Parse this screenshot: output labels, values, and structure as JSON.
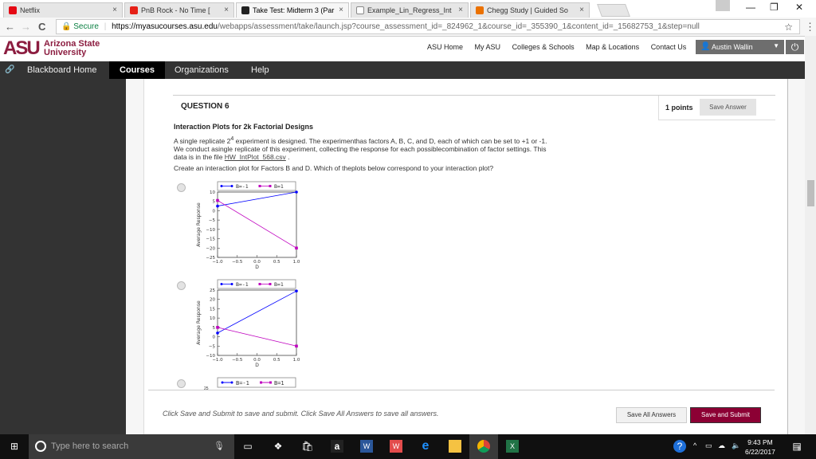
{
  "browser": {
    "tabs": [
      {
        "title": "Netflix",
        "favicon": "netflix-icon",
        "color": "#e50914"
      },
      {
        "title": "PnB Rock - No Time [",
        "favicon": "youtube-icon",
        "color": "#e62117",
        "audio": "◀"
      },
      {
        "title": "Take Test: Midterm 3 (Par",
        "favicon": "blackboard-icon",
        "color": "#222222",
        "active": true
      },
      {
        "title": "Example_Lin_Regress_Int",
        "favicon": "document-icon",
        "color": "#888888"
      },
      {
        "title": "Chegg Study | Guided So",
        "favicon": "chegg-icon",
        "color": "#eb7100"
      }
    ],
    "tab_close": "×",
    "address": {
      "secure_label": "Secure",
      "host": "https://myasucourses.asu.edu",
      "path": "/webapps/assessment/take/launch.jsp?course_assessment_id=_824962_1&course_id=_355390_1&content_id=_15682753_1&step=null"
    },
    "nav": {
      "back": "←",
      "forward": "→",
      "reload": "C"
    },
    "bookmark_icon": "☆",
    "menu_icon": "⋮",
    "window": {
      "minimize": "—",
      "maximize": "❐",
      "close": "✕",
      "profile": "▲"
    }
  },
  "asu_header": {
    "logo": "ASU",
    "name_line1": "Arizona State",
    "name_line2": "University",
    "links": [
      "ASU Home",
      "My ASU",
      "Colleges & Schools",
      "Map & Locations",
      "Contact Us"
    ],
    "user": "Austin Wallin",
    "power_icon": "⏻"
  },
  "bb_nav": {
    "items": [
      "Blackboard Home",
      "Courses",
      "Organizations",
      "Help"
    ],
    "active": "Courses"
  },
  "question": {
    "title": "QUESTION 6",
    "points": "1 points",
    "save_answer": "Save Answer",
    "heading": "Interaction Plots for 2k Factorial Designs",
    "p1_a": "A single replicate 2",
    "p1_sup": "4",
    "p1_b": " experiment is designed. The experimenthas factors A, B, C, and D, each of which can be set to +1 or -1.",
    "p2": "We conduct asingle replicate of this experiment, collecting the response for each possiblecombination of factor settings. This",
    "p3_a": "data is in the file ",
    "p3_link": "HW_IntPlot_568.csv",
    "p3_b": " .",
    "p4": "Create an interaction plot for Factors B and D. Which of theplots below correspond to your interaction plot?"
  },
  "chart_data": [
    {
      "type": "line",
      "title": "",
      "xlabel": "D",
      "ylabel": "Average Response",
      "x": [
        -1,
        1
      ],
      "xlim": [
        -1.0,
        1.0
      ],
      "ylim": [
        -25,
        10
      ],
      "xticks": [
        "−1.0",
        "−0.5",
        "0.0",
        "0.5",
        "1.0"
      ],
      "yticks": [
        10,
        5,
        0,
        -5,
        -10,
        -15,
        -20,
        -25
      ],
      "legend": "top",
      "series": [
        {
          "name": "B=-1",
          "values": [
            2.5,
            10
          ],
          "color": "#0000ff",
          "marker": "circle"
        },
        {
          "name": "B=1",
          "values": [
            5.5,
            -20
          ],
          "color": "#bf00bf",
          "marker": "square"
        }
      ]
    },
    {
      "type": "line",
      "title": "",
      "xlabel": "D",
      "ylabel": "Average Response",
      "x": [
        -1,
        1
      ],
      "xlim": [
        -1.0,
        1.0
      ],
      "ylim": [
        -10,
        25
      ],
      "xticks": [
        "−1.0",
        "−0.5",
        "0.0",
        "0.5",
        "1.0"
      ],
      "yticks": [
        25,
        20,
        15,
        10,
        5,
        0,
        -5,
        -10
      ],
      "legend": "top",
      "series": [
        {
          "name": "B=-1",
          "values": [
            2,
            24.5
          ],
          "color": "#0000ff",
          "marker": "circle"
        },
        {
          "name": "B=1",
          "values": [
            5,
            -5
          ],
          "color": "#bf00bf",
          "marker": "square"
        }
      ]
    }
  ],
  "third_option_partial": {
    "legend": [
      "B=-1",
      "B=1"
    ],
    "ytick_top": "25"
  },
  "footer": {
    "instruction": "Click Save and Submit to save and submit. Click Save All Answers to save all answers.",
    "save_all": "Save All Answers",
    "save_submit": "Save and Submit"
  },
  "taskbar": {
    "search_placeholder": "Type here to search",
    "time": "9:43 PM",
    "date": "6/22/2017",
    "notifications": "8"
  }
}
